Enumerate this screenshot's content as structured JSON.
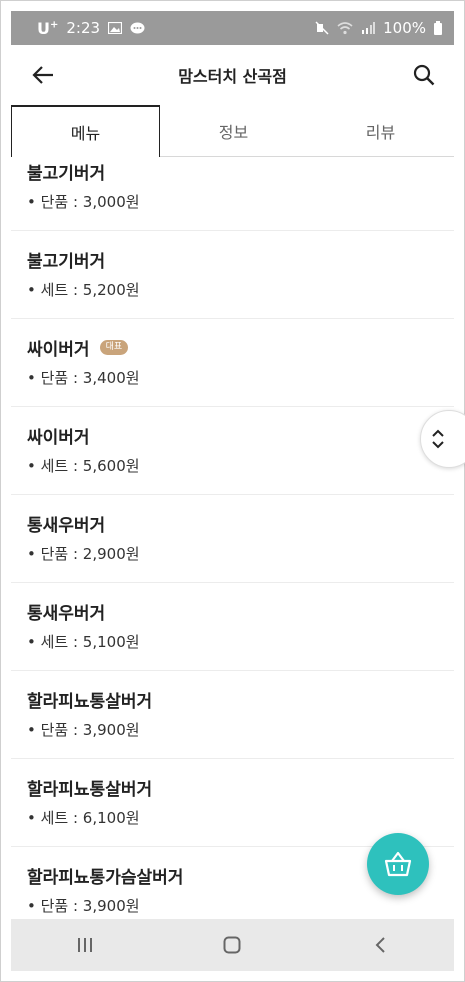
{
  "status_bar": {
    "carrier": "U",
    "carrier_sup": "+",
    "time": "2:23",
    "battery": "100%",
    "icons": [
      "image-icon",
      "chat-icon",
      "mute-icon",
      "wifi-icon",
      "signal-icon",
      "battery-icon"
    ]
  },
  "header": {
    "title": "맘스터치 산곡점",
    "back_icon": "arrow-left-icon",
    "search_icon": "search-icon"
  },
  "tabs": [
    {
      "label": "메뉴",
      "active": true
    },
    {
      "label": "정보",
      "active": false
    },
    {
      "label": "리뷰",
      "active": false
    }
  ],
  "menu_items": [
    {
      "name": "불고기버거",
      "price": "• 단품 : 3,000원",
      "badge": ""
    },
    {
      "name": "불고기버거",
      "price": "• 세트 : 5,200원",
      "badge": ""
    },
    {
      "name": "싸이버거",
      "price": "• 단품 : 3,400원",
      "badge": "대표"
    },
    {
      "name": "싸이버거",
      "price": "• 세트 : 5,600원",
      "badge": ""
    },
    {
      "name": "통새우버거",
      "price": "• 단품 : 2,900원",
      "badge": ""
    },
    {
      "name": "통새우버거",
      "price": "• 세트 : 5,100원",
      "badge": ""
    },
    {
      "name": "할라피뇨통살버거",
      "price": "• 단품 : 3,900원",
      "badge": ""
    },
    {
      "name": "할라피뇨통살버거",
      "price": "• 세트 : 6,100원",
      "badge": ""
    },
    {
      "name": "할라피뇨통가슴살버거",
      "price": "• 단품 : 3,900원",
      "badge": ""
    }
  ],
  "floating": {
    "scroll_icon": "chevron-up-down-icon",
    "cart_icon": "basket-icon"
  },
  "nav_bar": {
    "icons": [
      "recent-apps-icon",
      "home-icon",
      "back-icon"
    ]
  },
  "colors": {
    "accent": "#2ec1bd",
    "badge": "#c9a47b",
    "status_bar": "#9a9a9a",
    "nav_bar": "#e9e9e9"
  }
}
